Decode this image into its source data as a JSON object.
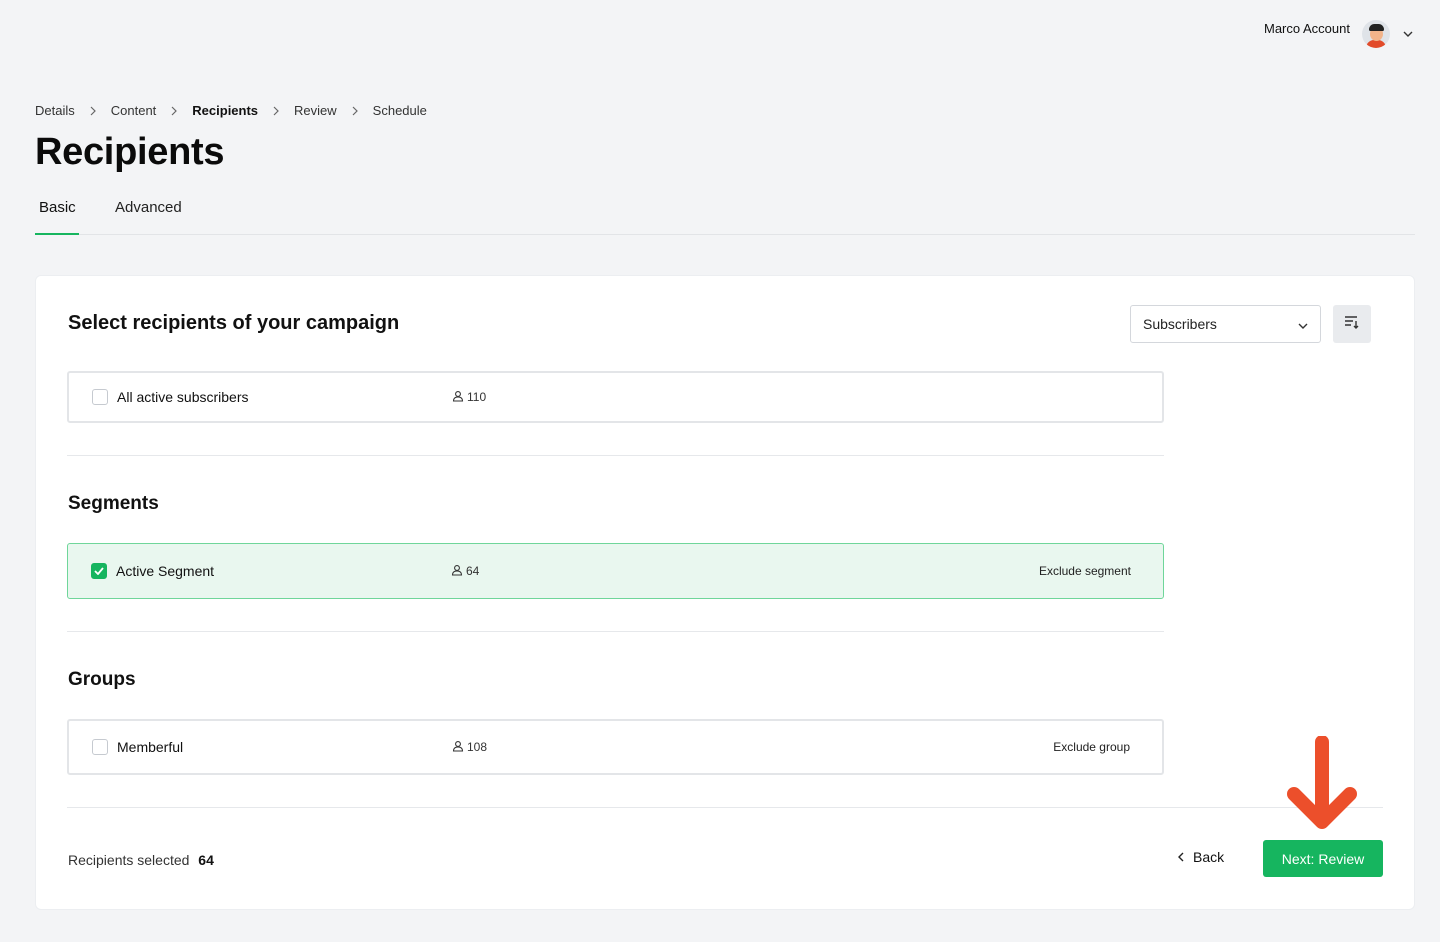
{
  "header": {
    "account_name": "Marco Account",
    "avatar_icon": "user-avatar",
    "dropdown_icon": "chevron-down-icon"
  },
  "breadcrumb": [
    {
      "label": "Details",
      "active": false
    },
    {
      "label": "Content",
      "active": false
    },
    {
      "label": "Recipients",
      "active": true
    },
    {
      "label": "Review",
      "active": false
    },
    {
      "label": "Schedule",
      "active": false
    }
  ],
  "page": {
    "title": "Recipients"
  },
  "tabs": [
    {
      "label": "Basic",
      "active": true
    },
    {
      "label": "Advanced",
      "active": false
    }
  ],
  "card": {
    "title": "Select recipients of your campaign",
    "filter_select": {
      "value": "Subscribers"
    },
    "sort_icon": "sort-icon"
  },
  "all_subscribers": {
    "label": "All active subscribers",
    "count": "110",
    "checked": false
  },
  "segments": {
    "title": "Segments",
    "items": [
      {
        "label": "Active Segment",
        "count": "64",
        "checked": true,
        "action": "Exclude segment"
      }
    ]
  },
  "groups": {
    "title": "Groups",
    "items": [
      {
        "label": "Memberful",
        "count": "108",
        "checked": false,
        "action": "Exclude group"
      }
    ]
  },
  "footer": {
    "summary_label": "Recipients selected",
    "summary_count": "64",
    "back_label": "Back",
    "next_label": "Next: Review"
  },
  "colors": {
    "accent": "#16b55f",
    "selected_bg": "#e9f7ef",
    "annotation_arrow": "#ec4f2b"
  }
}
